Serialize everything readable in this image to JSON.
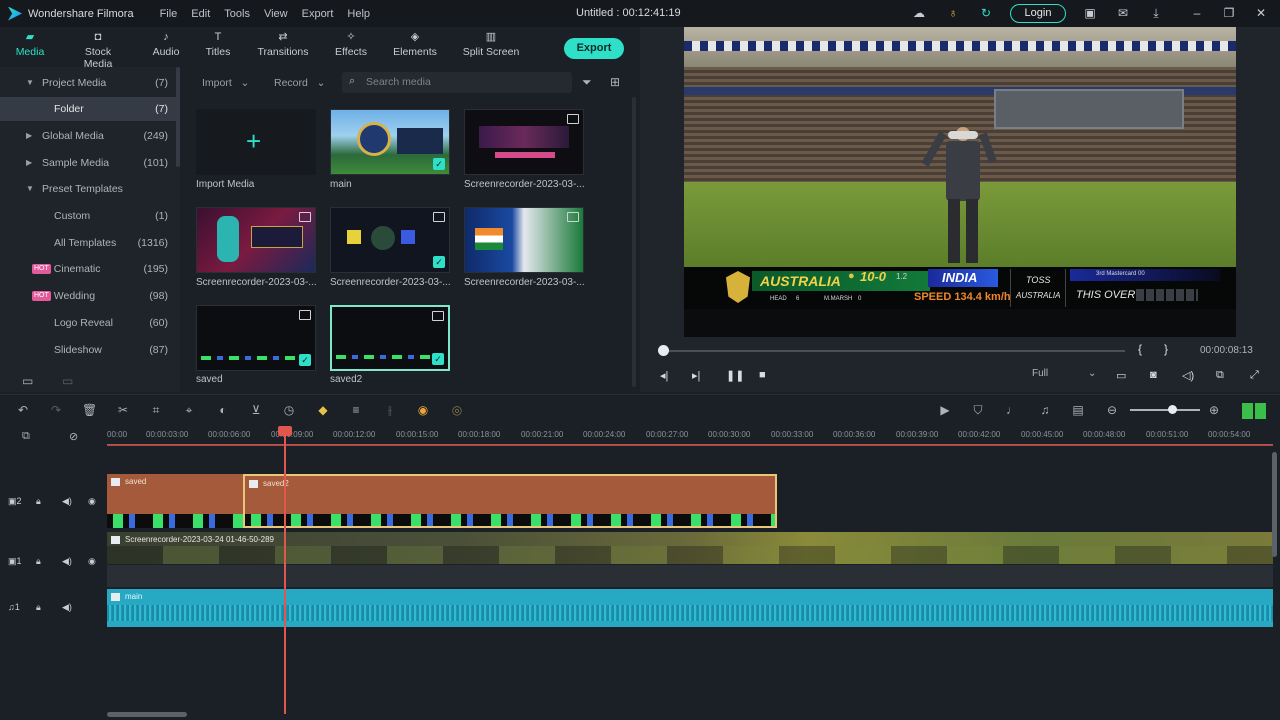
{
  "app": {
    "name": "Wondershare Filmora",
    "menu": [
      "File",
      "Edit",
      "Tools",
      "View",
      "Export",
      "Help"
    ],
    "project_title": "Untitled : 00:12:41:19",
    "login_label": "Login"
  },
  "tabs": [
    {
      "label": "Media",
      "icon": "folder-icon"
    },
    {
      "label": "Stock Media",
      "icon": "camera-icon"
    },
    {
      "label": "Audio",
      "icon": "music-note-icon"
    },
    {
      "label": "Titles",
      "icon": "text-icon"
    },
    {
      "label": "Transitions",
      "icon": "transition-icon"
    },
    {
      "label": "Effects",
      "icon": "sparkle-icon"
    },
    {
      "label": "Elements",
      "icon": "shapes-icon"
    },
    {
      "label": "Split Screen",
      "icon": "split-screen-icon"
    }
  ],
  "export_label": "Export",
  "sidebar": {
    "items": [
      {
        "label": "Project Media",
        "count": "(7)"
      },
      {
        "label": "Folder",
        "count": "(7)"
      },
      {
        "label": "Global Media",
        "count": "(249)"
      },
      {
        "label": "Sample Media",
        "count": "(101)"
      },
      {
        "label": "Preset Templates",
        "count": ""
      },
      {
        "label": "Custom",
        "count": "(1)"
      },
      {
        "label": "All Templates",
        "count": "(1316)"
      },
      {
        "label": "Cinematic",
        "count": "(195)",
        "badge": "HOT"
      },
      {
        "label": "Wedding",
        "count": "(98)",
        "badge": "HOT"
      },
      {
        "label": "Logo Reveal",
        "count": "(60)"
      },
      {
        "label": "Slideshow",
        "count": "(87)"
      }
    ]
  },
  "media": {
    "import_dropdown": "Import",
    "record_dropdown": "Record",
    "search_placeholder": "Search media",
    "items": [
      {
        "label": "Import Media"
      },
      {
        "label": "main"
      },
      {
        "label": "Screenrecorder-2023-03-..."
      },
      {
        "label": "Screenrecorder-2023-03-..."
      },
      {
        "label": "Screenrecorder-2023-03-..."
      },
      {
        "label": "Screenrecorder-2023-03-..."
      },
      {
        "label": "saved"
      },
      {
        "label": "saved2"
      }
    ]
  },
  "preview": {
    "scoreboard": {
      "team1": "AUSTRALIA",
      "score": "10-0",
      "overs": "1.2",
      "team2": "INDIA",
      "speed": "SPEED 134.4 km/h",
      "toss_label": "TOSS",
      "toss_team": "AUSTRALIA",
      "this_over": "THIS OVER",
      "batter1": "HEAD",
      "batter1_runs": "6",
      "batter2": "M.MARSH",
      "batter2_runs": "0",
      "bowler": "3rd Mastercard 00"
    },
    "timecode": "00:00:08:13",
    "quality": "Full"
  },
  "timeline": {
    "ruler_labels": [
      "00:00",
      "00:00:03:00",
      "00:00:06:00",
      "00:00:09:00",
      "00:00:12:00",
      "00:00:15:00",
      "00:00:18:00",
      "00:00:21:00",
      "00:00:24:00",
      "00:00:27:00",
      "00:00:30:00",
      "00:00:33:00",
      "00:00:36:00",
      "00:00:39:00",
      "00:00:42:00",
      "00:00:45:00",
      "00:00:48:00",
      "00:00:51:00",
      "00:00:54:00"
    ],
    "tracks": [
      {
        "id": "2",
        "clips": [
          {
            "name": "saved"
          },
          {
            "name": "saved2"
          }
        ]
      },
      {
        "id": "1",
        "clips": [
          {
            "name": "Screenrecorder-2023-03-24 01-46-50-289"
          }
        ]
      },
      {
        "id": "1",
        "clips": [
          {
            "name": "main"
          }
        ]
      }
    ]
  },
  "colors": {
    "accent": "#2ee0c8",
    "clip_video_overlay": "#a55a3c",
    "clip_audio": "#27a9c4",
    "playhead": "#e0574f"
  }
}
